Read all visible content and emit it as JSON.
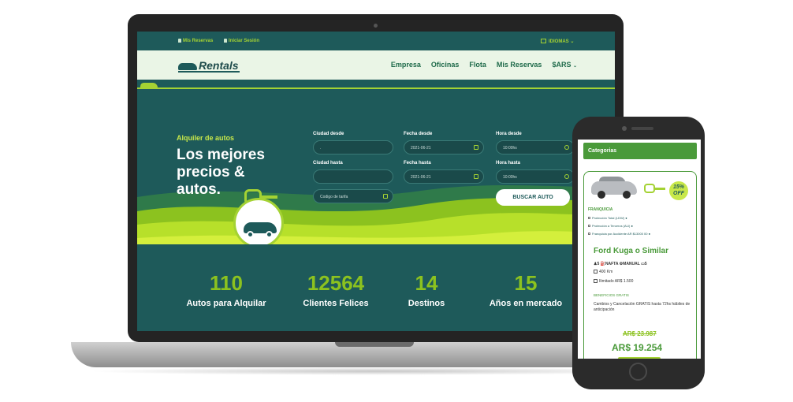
{
  "topbar": {
    "my_reservations": "Mis Reservas",
    "login": "Iniciar Sesión",
    "language": "IDIOMAS"
  },
  "navbar": {
    "logo_text": "Rentals",
    "items": [
      "Empresa",
      "Oficinas",
      "Flota",
      "Mis Reservas",
      "$ARS"
    ]
  },
  "hero": {
    "kicker": "Alquiler de autos",
    "title": "Los mejores precios & autos."
  },
  "search_form": {
    "city_from_label": "Ciudad desde",
    "city_to_label": "Ciudad hasta",
    "date_from_label": "Fecha desde",
    "date_to_label": "Fecha hasta",
    "time_from_label": "Hora desde",
    "time_to_label": "Hora hasta",
    "date_from_value": "2021-06-21",
    "date_to_value": "2021-06-21",
    "time_from_value": "10:00hs",
    "time_to_value": "10:00hs",
    "promo_placeholder": "Codigo de tarifa",
    "search_button": "BUSCAR AUTO"
  },
  "stats": [
    {
      "value": "110",
      "label": "Autos para Alquilar"
    },
    {
      "value": "12564",
      "label": "Clientes Felices"
    },
    {
      "value": "14",
      "label": "Destinos"
    },
    {
      "value": "15",
      "label": "Años en mercado"
    }
  ],
  "mobile": {
    "categories": "Categorias",
    "discount": "15% OFF",
    "franchise_label": "FRANQUICIA",
    "franchise_options": [
      "Protección Total (LDW)",
      "Protección a Terceros (ALI)",
      "Franquicia por Accidente AR $13000 00"
    ],
    "car_name": "Ford Kuga o Similar",
    "specs": [
      "5",
      "NAFTA",
      "MANUAL",
      "5"
    ],
    "km_option": "400 Km",
    "unlimited_option": "Ilimitado AR$ 1.500",
    "benefits_label": "BENEFICIOS GRATIS",
    "cancellation_text": "Cambios y Cancelación GRATIS hasta 72hs hábiles de anticipación",
    "old_price": "AR$ 23.987",
    "new_price": "AR$ 19.254"
  },
  "colors": {
    "teal": "#1e5a5a",
    "lime": "#a4d233",
    "green": "#4a9a3a",
    "nav_bg": "#eaf5e6"
  }
}
